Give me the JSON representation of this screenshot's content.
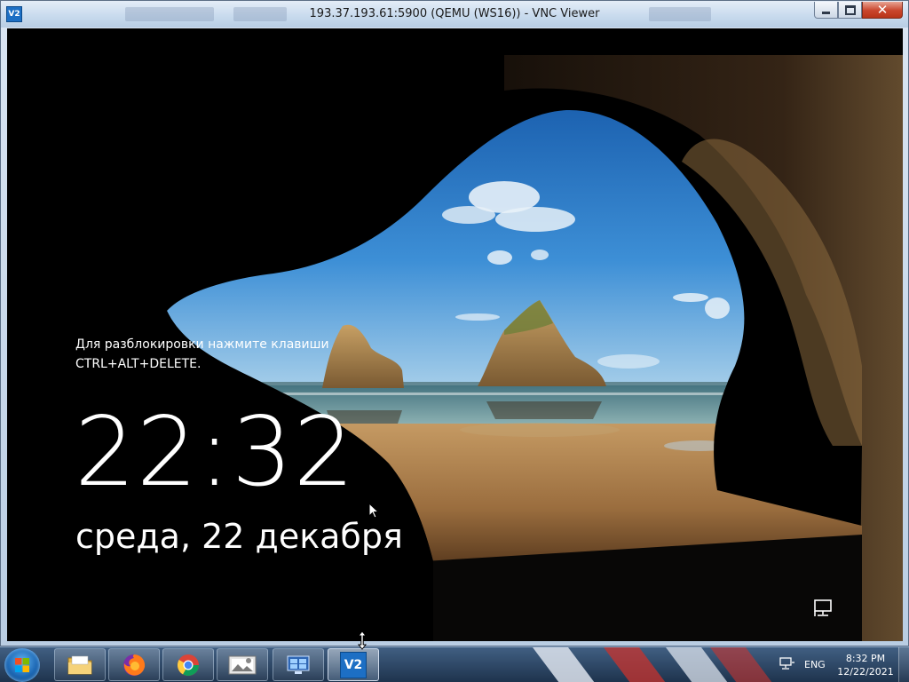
{
  "window": {
    "title": "193.37.193.61:5900 (QEMU (WS16)) - VNC Viewer",
    "icon_label": "V2"
  },
  "lock_screen": {
    "message_line1": "Для разблокировки нажмите клавиши",
    "message_line2": "CTRL+ALT+DELETE.",
    "time": "22:32",
    "date": "среда, 22 декабря"
  },
  "taskbar": {
    "items": [
      {
        "name": "file-explorer",
        "icon": "folder-icon"
      },
      {
        "name": "firefox",
        "icon": "firefox-icon"
      },
      {
        "name": "chrome",
        "icon": "chrome-icon"
      },
      {
        "name": "image-app",
        "icon": "image-app-icon"
      },
      {
        "name": "remote-desktop",
        "icon": "remote-desktop-icon"
      },
      {
        "name": "vnc-viewer",
        "icon": "vnc-viewer-icon",
        "label": "V2"
      }
    ],
    "tray": {
      "language": "ENG",
      "time": "8:32 PM",
      "date": "12/22/2021"
    }
  },
  "colors": {
    "titlebar": "#c9dbee",
    "close_button": "#c9452c",
    "start_orb": "#1c67b4",
    "lock_text": "#ffffff"
  }
}
